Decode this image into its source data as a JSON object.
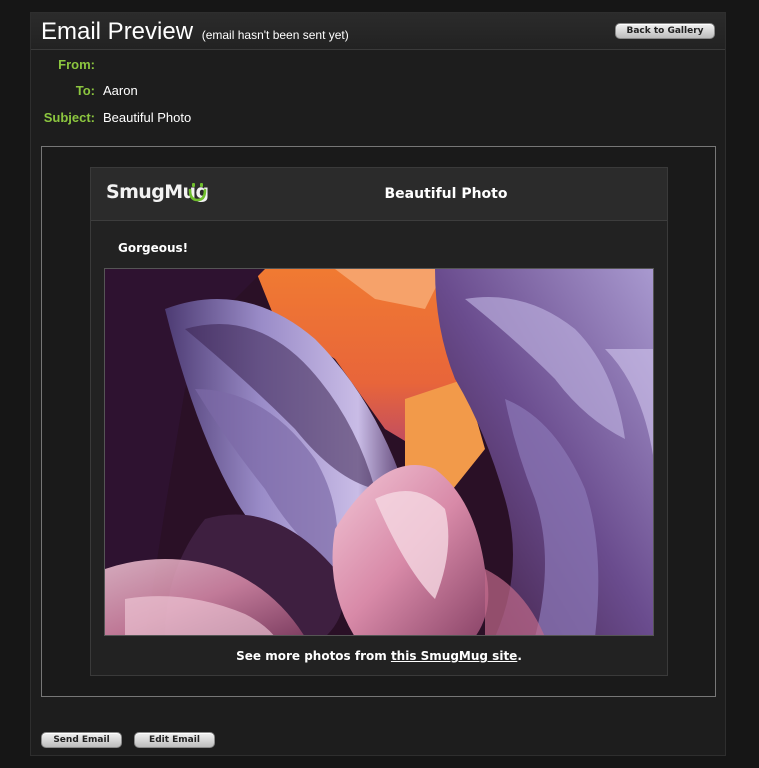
{
  "page": {
    "title": "Email Preview",
    "title_note": "(email hasn't been sent yet)",
    "back_button": "Back to Gallery"
  },
  "fields": {
    "from_label": "From:",
    "from_value": "",
    "to_label": "To:",
    "to_value": "Aaron",
    "subject_label": "Subject:",
    "subject_value": "Beautiful Photo"
  },
  "email": {
    "logo_text": "SmugMug",
    "logo_icon": "smugmug-smile-icon",
    "title": "Beautiful Photo",
    "message": "Gorgeous!",
    "photo_description": "slot canyon photo",
    "footer_prefix": "See more photos from ",
    "footer_link": "this SmugMug site",
    "footer_suffix": "."
  },
  "actions": {
    "send": "Send Email",
    "edit": "Edit Email"
  },
  "colors": {
    "label_green": "#8cc63f",
    "logo_green": "#6fbf2c"
  }
}
